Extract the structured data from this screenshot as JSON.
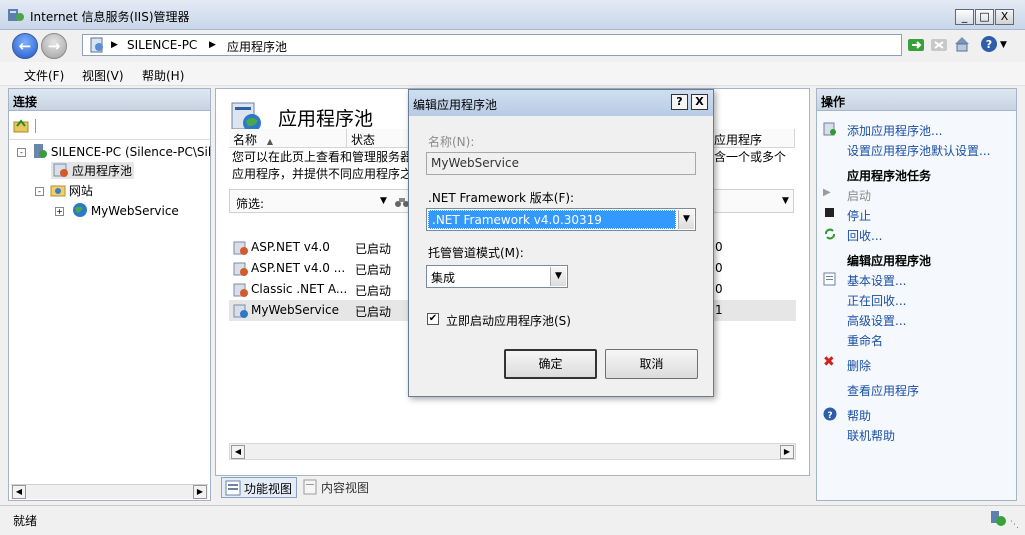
{
  "window": {
    "title": "Internet 信息服务(IIS)管理器",
    "controls": {
      "minimize": "_",
      "maximize": "□",
      "close": "X"
    }
  },
  "address": {
    "segments": [
      "SILENCE-PC",
      "应用程序池"
    ],
    "sep": "▶"
  },
  "menu": [
    "文件(F)",
    "视图(V)",
    "帮助(H)"
  ],
  "left": {
    "header": "连接",
    "tree": [
      {
        "label": "SILENCE-PC (Silence-PC\\Sil",
        "icon": "server-icon"
      },
      {
        "label": "应用程序池",
        "icon": "app-pool-icon"
      },
      {
        "label": "网站",
        "icon": "sites-folder-icon"
      },
      {
        "label": "MyWebService",
        "icon": "website-globe-icon"
      }
    ]
  },
  "center": {
    "title": "应用程序池",
    "description_l1": "您可以在此页上查看和管理服务器",
    "description_l2": "应用程序，并提供不同应用程序之",
    "description_r": "含一个或多个",
    "filter_label": "筛选:",
    "columns": {
      "name": "名称",
      "sort_glyph": "▲",
      "status": "状态",
      "apps": "应用程序"
    },
    "rows": [
      {
        "name": "ASP.NET v4.0",
        "status": "已启动",
        "apps": "0"
      },
      {
        "name": "ASP.NET v4.0 ...",
        "status": "已启动",
        "apps": "0"
      },
      {
        "name": "Classic .NET A...",
        "status": "已启动",
        "apps": "0"
      },
      {
        "name": "MyWebService",
        "status": "已启动",
        "apps": "1"
      }
    ],
    "view_tabs": {
      "feature": "功能视图",
      "content": "内容视图"
    }
  },
  "right": {
    "header": "操作",
    "add_pool": "添加应用程序池...",
    "set_defaults": "设置应用程序池默认设置...",
    "tasks_header": "应用程序池任务",
    "start": "启动",
    "stop": "停止",
    "recycle": "回收...",
    "edit_header": "编辑应用程序池",
    "basic_settings": "基本设置...",
    "recycling": "正在回收...",
    "advanced": "高级设置...",
    "rename": "重命名",
    "delete": "删除",
    "view_apps": "查看应用程序",
    "help": "帮助",
    "online_help": "联机帮助"
  },
  "dialog": {
    "title": "编辑应用程序池",
    "help_btn": "?",
    "close_btn": "X",
    "name_label": "名称(N):",
    "name_value": "MyWebService",
    "framework_label": ".NET Framework 版本(F):",
    "framework_value": ".NET Framework v4.0.30319",
    "pipeline_label": "托管管道模式(M):",
    "pipeline_value": "集成",
    "autostart_label": "立即启动应用程序池(S)",
    "autostart_checked": "✔",
    "ok": "确定",
    "cancel": "取消"
  },
  "status": {
    "text": "就绪"
  },
  "colors": {
    "selection": "#3399ff",
    "link": "#1a4fa3"
  }
}
